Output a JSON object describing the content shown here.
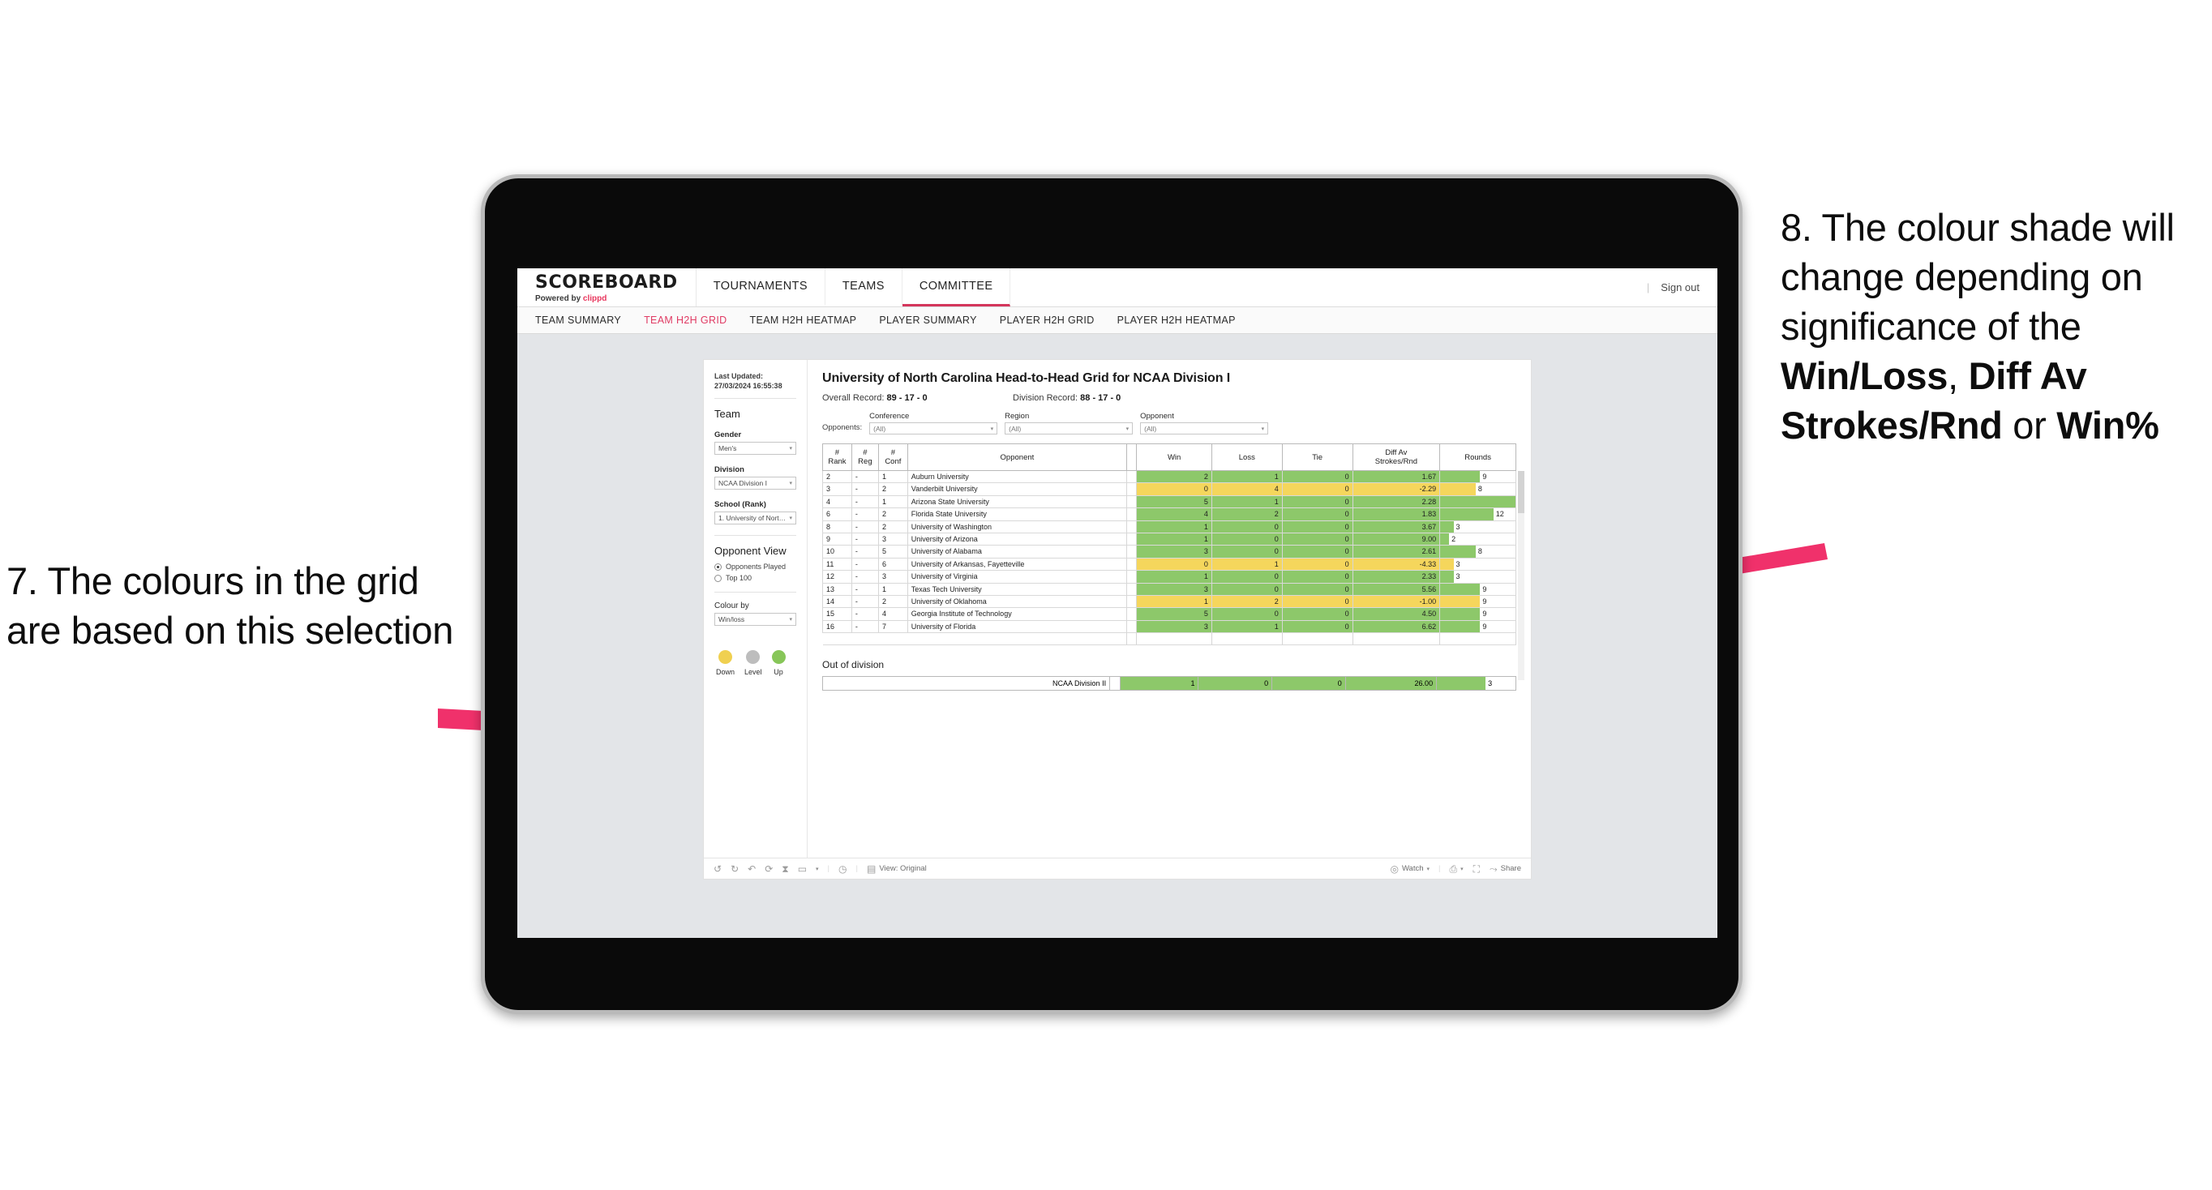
{
  "annotations": {
    "left": {
      "number": "7.",
      "text": "7. The colours in the grid are based on this selection"
    },
    "right": {
      "line1": "8. The colour shade will change depending on significance of the ",
      "bold1": "Win/Loss",
      "mid1": ", ",
      "bold2": "Diff Av Strokes/Rnd",
      "mid2": " or ",
      "bold3": "Win%"
    },
    "arrow_color": "#F0316B"
  },
  "app": {
    "brand": {
      "title": "SCOREBOARD",
      "powered": "Powered by",
      "partner": "clippd"
    },
    "nav": [
      {
        "label": "TOURNAMENTS",
        "active": false
      },
      {
        "label": "TEAMS",
        "active": false
      },
      {
        "label": "COMMITTEE",
        "active": true
      }
    ],
    "signout": "Sign out",
    "subnav": [
      {
        "label": "TEAM SUMMARY",
        "active": false
      },
      {
        "label": "TEAM H2H GRID",
        "active": true
      },
      {
        "label": "TEAM H2H HEATMAP",
        "active": false
      },
      {
        "label": "PLAYER SUMMARY",
        "active": false
      },
      {
        "label": "PLAYER H2H GRID",
        "active": false
      },
      {
        "label": "PLAYER H2H HEATMAP",
        "active": false
      }
    ]
  },
  "sidebar": {
    "last_updated_label": "Last Updated:",
    "last_updated_value": "27/03/2024 16:55:38",
    "team_heading": "Team",
    "gender_label": "Gender",
    "gender_value": "Men's",
    "division_label": "Division",
    "division_value": "NCAA Division I",
    "school_label": "School (Rank)",
    "school_value": "1. University of Nort…",
    "opponent_view_heading": "Opponent View",
    "opponent_view_options": [
      {
        "label": "Opponents Played",
        "selected": true
      },
      {
        "label": "Top 100",
        "selected": false
      }
    ],
    "colour_by_label": "Colour by",
    "colour_by_value": "Win/loss",
    "legend": [
      {
        "label": "Down",
        "color": "#F0D050"
      },
      {
        "label": "Level",
        "color": "#BDBDBD"
      },
      {
        "label": "Up",
        "color": "#87C659"
      }
    ]
  },
  "main": {
    "title": "University of North Carolina Head-to-Head Grid for NCAA Division I",
    "overall_record_label": "Overall Record:",
    "overall_record_value": "89 - 17 - 0",
    "division_record_label": "Division Record:",
    "division_record_value": "88 - 17 - 0",
    "opponents_label": "Opponents:",
    "filters": [
      {
        "caption": "Conference",
        "value": "(All)"
      },
      {
        "caption": "Region",
        "value": "(All)"
      },
      {
        "caption": "Opponent",
        "value": "(All)"
      }
    ],
    "out_of_division_title": "Out of division",
    "out_of_division_row": {
      "name": "NCAA Division II",
      "win": "1",
      "loss": "0",
      "tie": "0",
      "diff": "26.00",
      "rounds": "3",
      "color": "#8DC86A"
    }
  },
  "table": {
    "headers": [
      "#\nRank",
      "#\nReg",
      "#\nConf",
      "Opponent",
      "Win",
      "Loss",
      "Tie",
      "Diff Av\nStrokes/Rnd",
      "Rounds"
    ],
    "header_lines": {
      "rank": [
        "#",
        "Rank"
      ],
      "reg": [
        "#",
        "Reg"
      ],
      "conf": [
        "#",
        "Conf"
      ],
      "opponent": [
        "Opponent"
      ],
      "win": [
        "Win"
      ],
      "loss": [
        "Loss"
      ],
      "tie": [
        "Tie"
      ],
      "diff": [
        "Diff Av",
        "Strokes/Rnd"
      ],
      "rounds": [
        "Rounds"
      ]
    },
    "colors": {
      "up": "#8DC86A",
      "down": "#F5D65C",
      "level": "#BDBDBD"
    },
    "max_rounds": 17,
    "rows": [
      {
        "rank": "2",
        "reg": "-",
        "conf": "1",
        "opponent": "Auburn University",
        "win": "2",
        "loss": "1",
        "tie": "0",
        "diff": "1.67",
        "rounds": "9",
        "state": "up"
      },
      {
        "rank": "3",
        "reg": "-",
        "conf": "2",
        "opponent": "Vanderbilt University",
        "win": "0",
        "loss": "4",
        "tie": "0",
        "diff": "-2.29",
        "rounds": "8",
        "state": "down"
      },
      {
        "rank": "4",
        "reg": "-",
        "conf": "1",
        "opponent": "Arizona State University",
        "win": "5",
        "loss": "1",
        "tie": "0",
        "diff": "2.28",
        "rounds": "17",
        "state": "up"
      },
      {
        "rank": "6",
        "reg": "-",
        "conf": "2",
        "opponent": "Florida State University",
        "win": "4",
        "loss": "2",
        "tie": "0",
        "diff": "1.83",
        "rounds": "12",
        "state": "up"
      },
      {
        "rank": "8",
        "reg": "-",
        "conf": "2",
        "opponent": "University of Washington",
        "win": "1",
        "loss": "0",
        "tie": "0",
        "diff": "3.67",
        "rounds": "3",
        "state": "up"
      },
      {
        "rank": "9",
        "reg": "-",
        "conf": "3",
        "opponent": "University of Arizona",
        "win": "1",
        "loss": "0",
        "tie": "0",
        "diff": "9.00",
        "rounds": "2",
        "state": "up"
      },
      {
        "rank": "10",
        "reg": "-",
        "conf": "5",
        "opponent": "University of Alabama",
        "win": "3",
        "loss": "0",
        "tie": "0",
        "diff": "2.61",
        "rounds": "8",
        "state": "up"
      },
      {
        "rank": "11",
        "reg": "-",
        "conf": "6",
        "opponent": "University of Arkansas, Fayetteville",
        "win": "0",
        "loss": "1",
        "tie": "0",
        "diff": "-4.33",
        "rounds": "3",
        "state": "down"
      },
      {
        "rank": "12",
        "reg": "-",
        "conf": "3",
        "opponent": "University of Virginia",
        "win": "1",
        "loss": "0",
        "tie": "0",
        "diff": "2.33",
        "rounds": "3",
        "state": "up"
      },
      {
        "rank": "13",
        "reg": "-",
        "conf": "1",
        "opponent": "Texas Tech University",
        "win": "3",
        "loss": "0",
        "tie": "0",
        "diff": "5.56",
        "rounds": "9",
        "state": "up"
      },
      {
        "rank": "14",
        "reg": "-",
        "conf": "2",
        "opponent": "University of Oklahoma",
        "win": "1",
        "loss": "2",
        "tie": "0",
        "diff": "-1.00",
        "rounds": "9",
        "state": "down"
      },
      {
        "rank": "15",
        "reg": "-",
        "conf": "4",
        "opponent": "Georgia Institute of Technology",
        "win": "5",
        "loss": "0",
        "tie": "0",
        "diff": "4.50",
        "rounds": "9",
        "state": "up"
      },
      {
        "rank": "16",
        "reg": "-",
        "conf": "7",
        "opponent": "University of Florida",
        "win": "3",
        "loss": "1",
        "tie": "0",
        "diff": "6.62",
        "rounds": "9",
        "state": "up"
      }
    ]
  },
  "toolbar": {
    "icons": [
      "undo-icon",
      "redo-icon",
      "revert-icon",
      "refresh-icon",
      "pause-icon",
      "highlight-icon",
      "caret-icon",
      "clock-icon"
    ],
    "view_label": "View: Original",
    "watch_label": "Watch",
    "share_label": "Share"
  }
}
